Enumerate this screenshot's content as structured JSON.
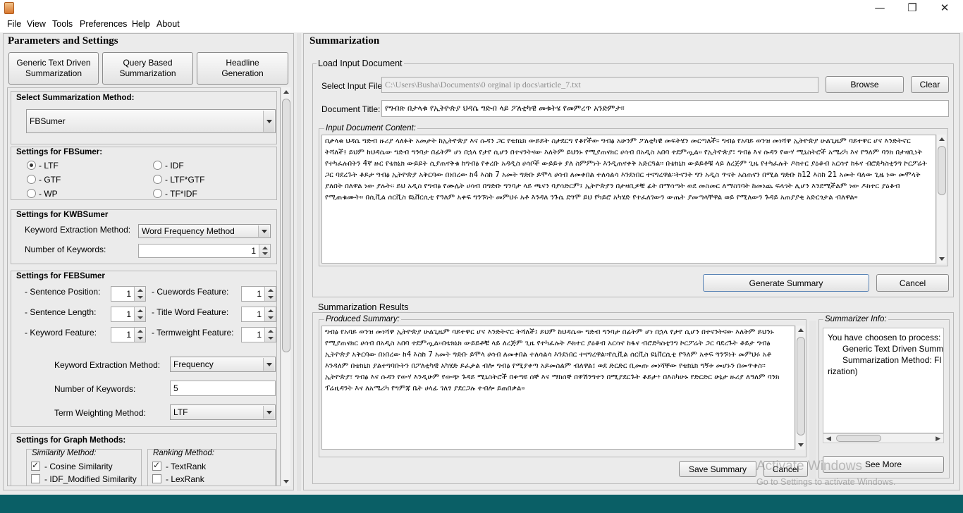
{
  "menu": [
    "File",
    "View",
    "Tools",
    "Preferences",
    "Help",
    "About"
  ],
  "window_controls": {
    "minimize": "—",
    "maximize": "❐",
    "close": "✕"
  },
  "left": {
    "title": "Parameters and Settings",
    "mode_buttons": [
      {
        "line1": "Generic Text Driven",
        "line2": "Summarization"
      },
      {
        "line1": "Query Based",
        "line2": "Summarization"
      },
      {
        "line1": "Headline",
        "line2": "Generation"
      }
    ],
    "select_method": {
      "title": "Select Summarization Method:",
      "value": "FBSumer"
    },
    "fbsumer": {
      "title": "Settings for FBSumer:",
      "options": [
        "- LTF",
        "- IDF",
        "- GTF",
        "- LTF*GTF",
        "- WP",
        "- TF*IDF"
      ],
      "selected": "- LTF"
    },
    "kwbsumer": {
      "title": "Settings for KWBSumer",
      "method_label": "Keyword Extraction Method:",
      "method_value": "Word Frequency Method",
      "num_label": "Number of Keywords:",
      "num_value": "1"
    },
    "febsumer": {
      "title": "Settings for FEBSumer",
      "features": [
        {
          "label": "- Sentence Position:",
          "value": "1"
        },
        {
          "label": "- Cuewords Feature:",
          "value": "1"
        },
        {
          "label": "- Sentence Length:",
          "value": "1"
        },
        {
          "label": "- Title Word Feature:",
          "value": "1"
        },
        {
          "label": "- Keyword Feature:",
          "value": "1"
        },
        {
          "label": "- Termweight Feature:",
          "value": "1"
        }
      ],
      "kw_method_label": "Keyword Extraction Method:",
      "kw_method_value": "Frequency",
      "num_kw_label": "Number of Keywords:",
      "num_kw_value": "5",
      "tw_method_label": "Term Weighting Method:",
      "tw_method_value": "LTF"
    },
    "graph": {
      "title": "Settings for Graph Methods:",
      "similarity_title": "Similarity Method:",
      "similarity": [
        {
          "label": "- Cosine Similarity",
          "checked": true
        },
        {
          "label": "- IDF_Modified Similarity",
          "checked": false
        }
      ],
      "ranking_title": "Ranking Method:",
      "ranking": [
        {
          "label": "- TextRank",
          "checked": true
        },
        {
          "label": "- LexRank",
          "checked": false
        }
      ]
    }
  },
  "right": {
    "title": "Summarization",
    "load": {
      "title": "Load Input Document",
      "input_file_label": "Select Input File:",
      "input_file_value": "C:\\Users\\Busha\\Documents\\0  orginal ip docs\\article_7.txt",
      "browse": "Browse",
      "clear": "Clear",
      "doc_title_label": "Document Title:",
      "doc_title_value": "የግብጽ በታላቁ የኢትዮጵያ ህዳሴ ግድብ ላይ ፖለቲካዊ መቁትሄ የመምረጥ አንድምታ፡፡",
      "content_title": "Input Document Content:",
      "content": "በታላቁ ህዳሴ ግድብ ዙሪያ ላለፉት አመታት ከኢትዮጵያ እና ሱዳን ጋር የቴክኒክ ውይይት ስታደርግ የቆየችው ግብፅ አሁንም ፖለቲካዊ መፍትሄን መርጣለች፡፡ ግብፅ የአባይ ወንዝ መነሻዋ ኢትዮጵያ ሁልጊዜም ባይተዋር ሆና እንድትኖር ትሻለች፤ ይህም ከህዳሴው ግድብ ግንባታ በፊትም ሆነ በኋላ የታየ ሲሆን በተናንትናው እለትም ይህንኑ የሚያጠናክር ሀሳብ በአዲስ አበባ ተደምጧል፡፡ የኢትዮጵያ፣ ግብፅ እና ሱዳን የውሃ ሚኒስትሮች አሜሪካ እና የዓለም ባንክ በታዛቢነት የተካፈሉበትን 4ኛ ዙር የቴክኒክ ውይይት ሲያጠናቅቁ ከግብፅ የቀረቡ አዳዲስ ሀሳቦች ውይይቱ ያለ ስምምነት እንዲጠናቀቅ አድርጓል፡፡ በቴክኒክ ውይይቶቹ ላይ ለረጅም ጊዜ የተካፈሉት ዶክተር ያዕቆብ አርሳኖ ከፋና ብሮድካስቲንግ ኮርፖሬት ጋር ባደረጉት ቆይታ ግብፅ ኢትዮጵያ አቅርባው በነበረው ከ4 እስከ 7 አመት ግድቡ ይሞላ ሀሳብ ለመቀበል ተለሳልሳ እንደነበር ተናግረዋል፡፡ትናንት ግን አዲስ ጥናት አስጠናን በሚል ግድቡ ከ12 እስከ 21 አመት ባለው ጊዜ ነው መሞላት ያለበት በለዋል ነው ያሉት፡፡ ይህ አዲስ የግብፅ የሙሌት ሀሳብ በግድቡ ግንባታ ላይ ጫናን ባያሳድርም፤ ኢትዮጵያን በታዛቢዎቹ ፊት በማሳጣት ወደ መስመር ለማስገባት ከመነጨ ፍላጎት ሊሆን እንደሚችልም ነው ዶክተር ያዕቆብ የሚጠቁሙት፡፡ በሲቪል ሰርቪስ ዩኒቨርሲቲ የዓለም አቀፍ ግንኙነት መምህሩ አቶ እንዳለ ንጉሴ ደግሞ ይህ የካይሮ አካሄድ የተፈለገውን ውጤት ያመጣላቸዋል ወይ የሚለውን ጉዳይ አጠያያቂ አድርጎታል ብለዋል።"
    },
    "buttons": {
      "generate": "Generate Summary",
      "cancel": "Cancel"
    },
    "results": {
      "title": "Summarization Results",
      "produced_title": "Produced Summary:",
      "produced": "ግብፅ የአባይ ወንዝ መነሻዋ ኢትዮጵያ ሁልጊዜም ባይተዋር ሆና እንድትኖር ትሻለች፤ ይህም ከህዳሴው ግድብ ግንባታ በፊትም ሆነ በኋላ የታየ ሲሆን በተናንትናው እለትም ይህንኑ የሚያጠናክር ሀሳብ በአዲስ አበባ ተደምጧል፡፡በቴክኒክ ውይይቶቹ ላይ ለረጅም ጊዜ የተካፈሉት ዶክተር ያዕቆብ አርሳኖ ከፋና ብሮድካስቲንግ ኮርፖሬት ጋር ባደረጉት ቆይታ ግብፅ ኢትዮጵያ አቅርባው በነበረው ከ4 እስከ 7 አመት ግድቡ ይሞላ ሀሳብ ለመቀበል ተለሳልሳ እንደነበር ተናግረዋል፡፡የሲቪል ሰርቪስ ዩኒቨርሲቲ የዓለም አቀፍ ግንኙነት መምህሩ አቶ እንዳለም በቴክኒክ ያልተግባቡትን በፖለቲካዊ አካሄድ ይፈታል ብሎ ግብፅ የሚያቀጣ አይመስልም ብለዋል፤ ወደ ድርድር ቢመጡ መነሻቸው የቴክኒክ ግኝቱ መሆኑን በመጥቀስ፡፡ኢትዮጵያ፣ ግብፅ እና ሱዳን የውሃ እንዲሁም የውጭ ጉዳይ ሚኒስትሮች በቀጣዩ ሰኞ እና ማክሰኞ በዋሽንግተን በሚያደርጉት ቆይታ፥ በእስካሁኑ የድርድር ሁኔታ ዙሪያ ለዓለም ባንክ ፕሬዚዳንት እና ለአሜሪካ የግምጃ ቤት ሀላፊ ገለፃ ያደርጋሉ ተብሎ ይጠበቃል፡፡",
      "save": "Save Summary",
      "cancel": "Cancel"
    },
    "info": {
      "title": "Summarizer Info:",
      "line1": "You have choosen to process:",
      "line2": "Generic Text Driven Summ",
      "line3": "Summarization  Method:  FI",
      "line4": "rization)",
      "see_more": "See More"
    },
    "watermark": {
      "line1": "Activate Windows",
      "line2": "Go to Settings to activate Windows."
    }
  },
  "colors": {
    "taskbar": "#0a5f66",
    "panel": "#ebebeb",
    "accent": "#3a6ea5"
  }
}
